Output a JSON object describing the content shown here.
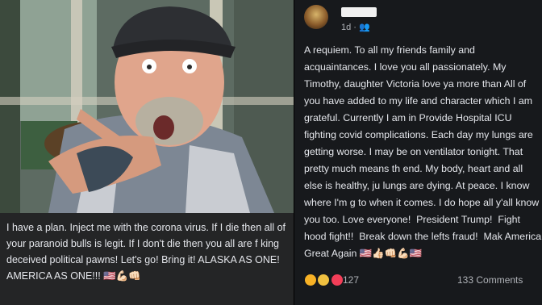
{
  "left_post": {
    "caption": "I have a plan. Inject me with the corona virus. If I die then all of your paranoid bulls      is legit. If I don't die then you all are f      king deceived political pawns!  Let's go!  Bring it!  ALASKA AS ONE! AMERICA AS ONE!!! 🇺🇸💪🏻👊🏻"
  },
  "right_post": {
    "meta": "1d · 👥",
    "body": "A requiem. To all my friends family and acquaintances. I love you all passionately. My Timothy, daughter Victoria love ya more than All of you have added to my life and character which I am grateful. Currently I am in Provide Hospital ICU fighting covid complications. Each day my lungs are getting worse. I may be on ventilator tonight. That pretty much means th end. My body, heart and all else is healthy, ju lungs are dying. At peace. I know where I'm g to when it comes. I do hope all y'all know you too. Love everyone!  President Trump!  Fight hood fight!!  Break down the lefts fraud!  Mak America Great Again 🇺🇸👍🏻👊🏻💪🏻🇺🇸",
    "reaction_count": "127",
    "comments": "133 Comments"
  }
}
